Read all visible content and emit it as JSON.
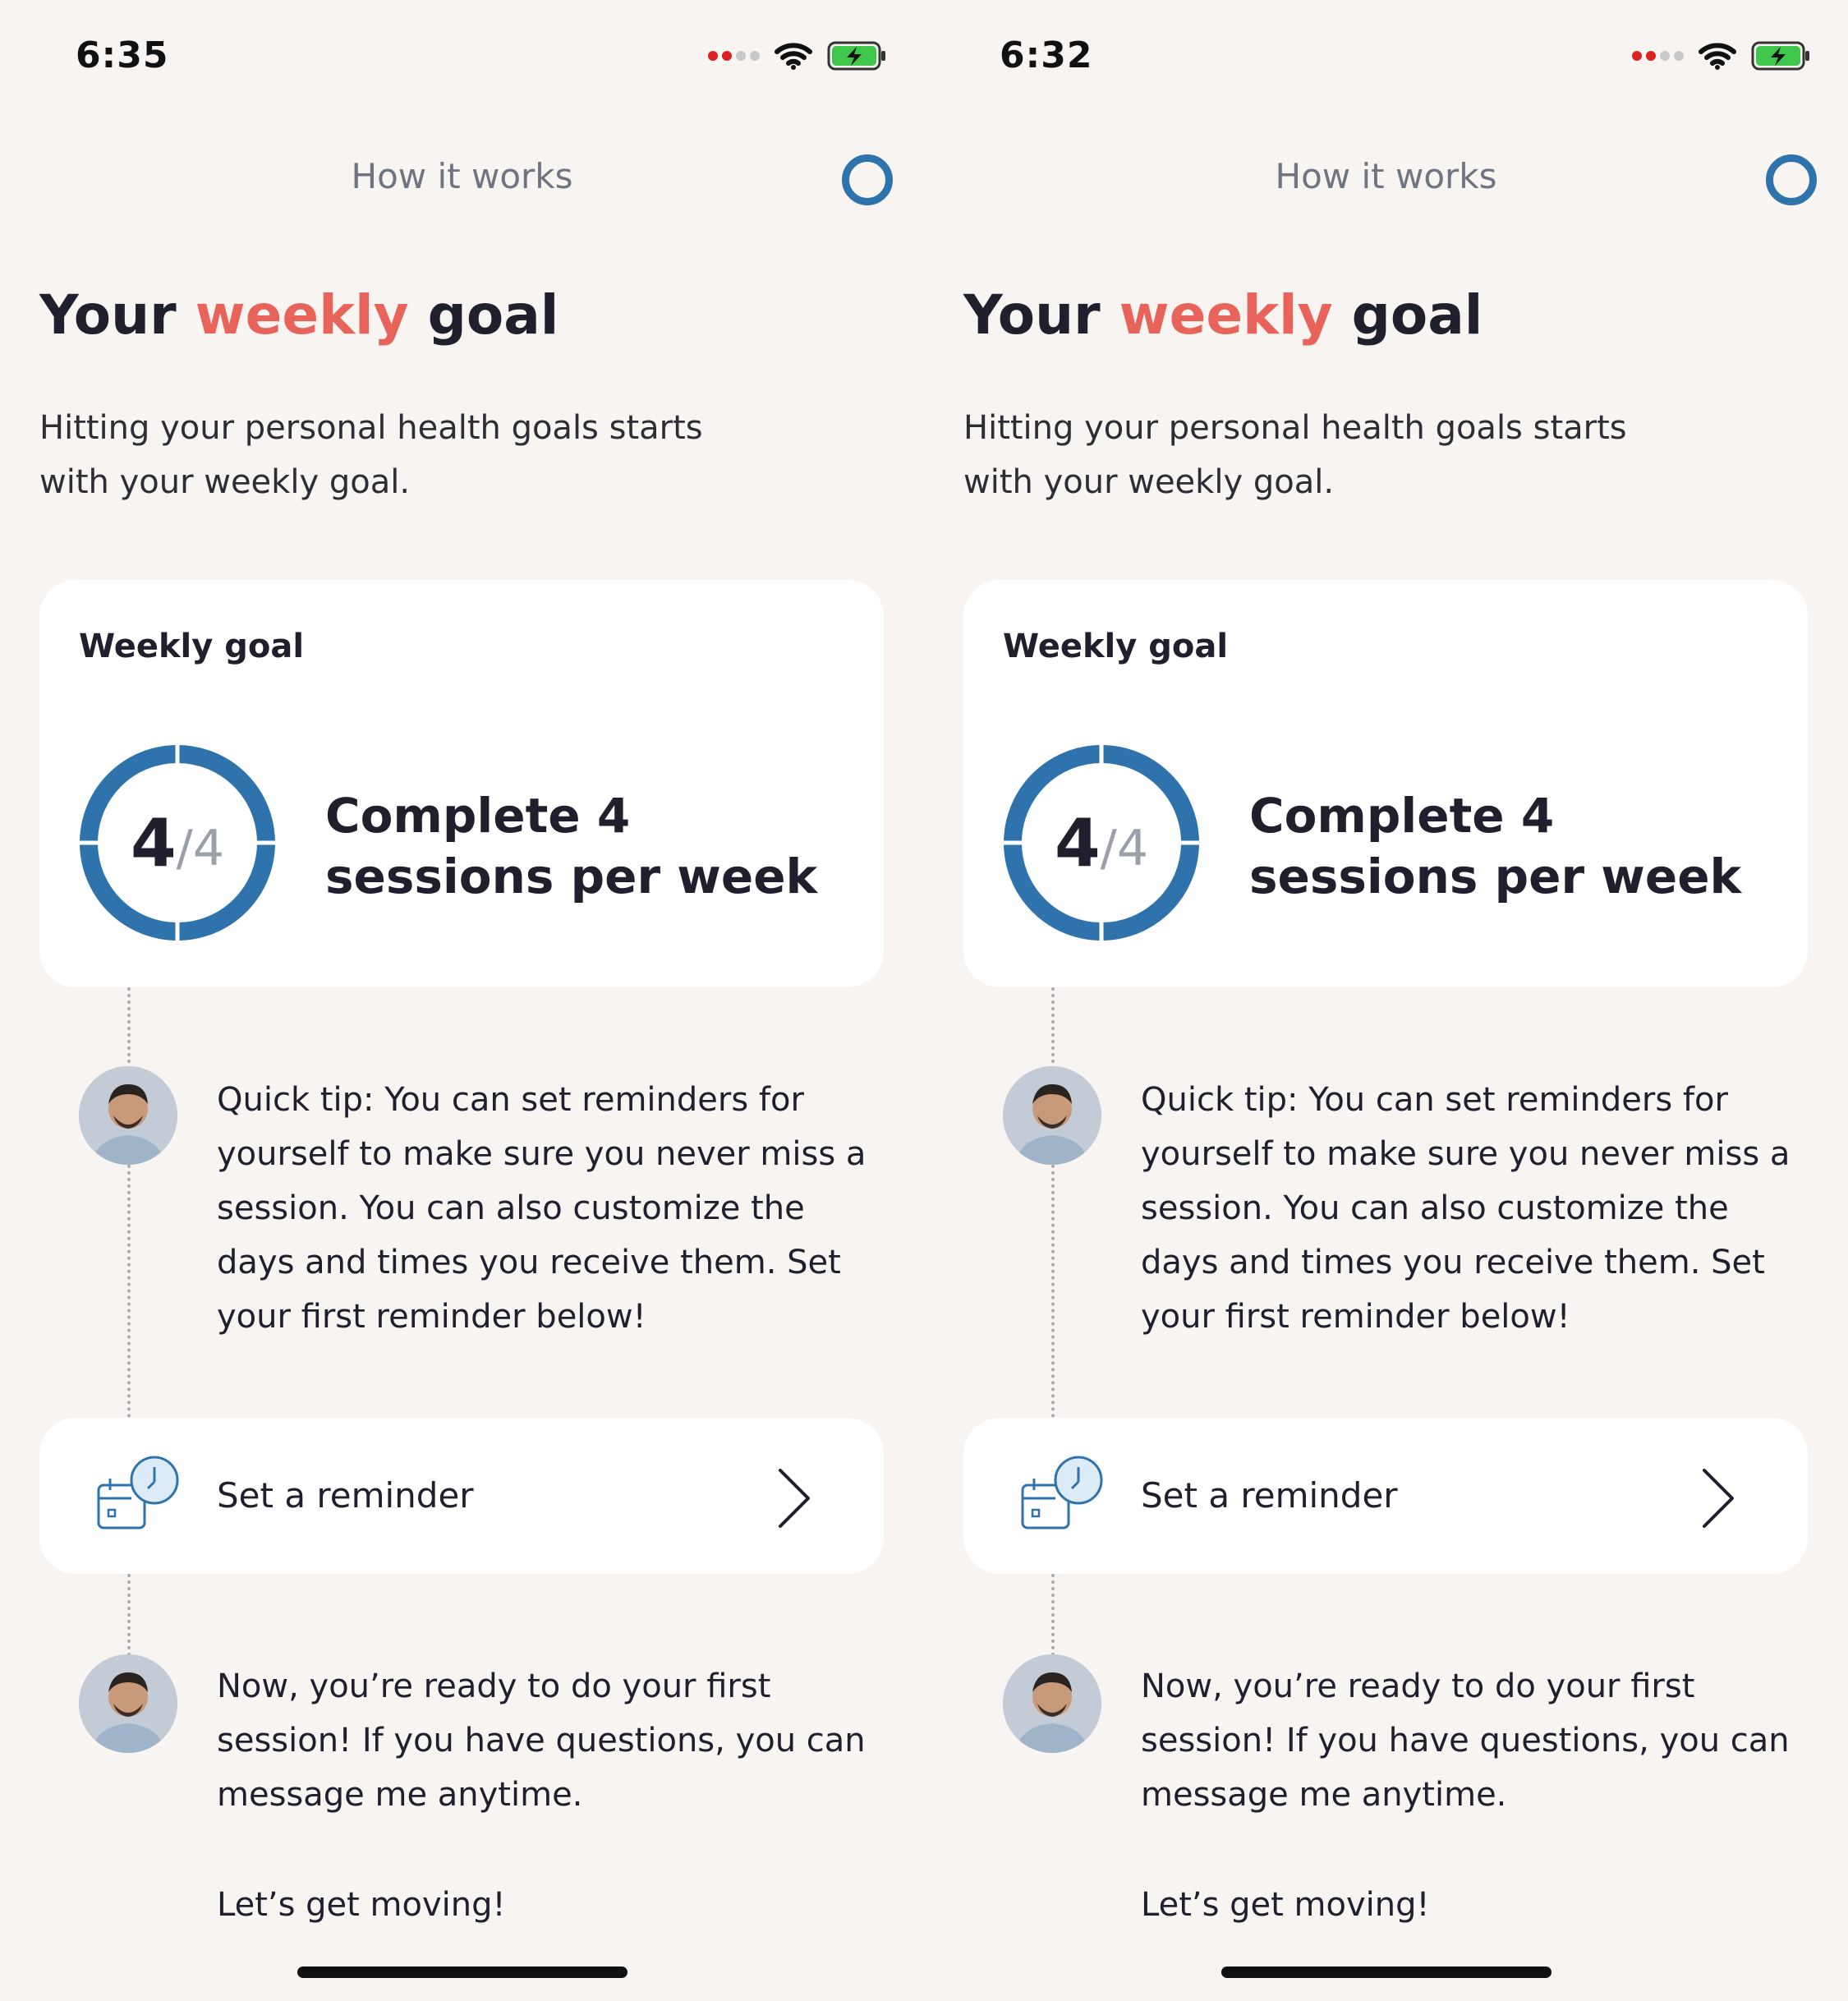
{
  "screens": [
    {
      "status": {
        "time": "6:35"
      },
      "header": {
        "title": "How it works"
      },
      "heading": {
        "prefix": "Your",
        "accent": "weekly",
        "suffix": "goal"
      },
      "subtitle": "Hitting your personal health goals starts with your weekly goal.",
      "goal_card": {
        "label": "Weekly goal",
        "progress_done": "4",
        "progress_total": "/4",
        "description": "Complete 4 sessions per week"
      },
      "tip": {
        "text": "Quick tip: You can set reminders for yourself to make sure you never miss a session. You can also customize the days and times you receive them. Set your first reminder below!"
      },
      "reminder": {
        "label": "Set a reminder"
      },
      "final_message": {
        "line1": "Now, you’re ready to do your first session! If you have questions, you can message me anytime.",
        "line2": "Let’s get moving!"
      }
    },
    {
      "status": {
        "time": "6:32"
      },
      "header": {
        "title": "How it works"
      },
      "heading": {
        "prefix": "Your",
        "accent": "weekly",
        "suffix": "goal"
      },
      "subtitle": "Hitting your personal health goals starts with your weekly goal.",
      "goal_card": {
        "label": "Weekly goal",
        "progress_done": "4",
        "progress_total": "/4",
        "description": "Complete 4 sessions per week"
      },
      "tip": {
        "text": "Quick tip: You can set reminders for yourself to make sure you never miss a session. You can also customize the days and times you receive them. Set your first reminder below!"
      },
      "reminder": {
        "label": "Set a reminder"
      },
      "final_message": {
        "line1": "Now, you’re ready to do your first session! If you have questions, you can message me anytime.",
        "line2": "Let’s get moving!"
      }
    }
  ],
  "colors": {
    "accent": "#e8645a",
    "brand_blue": "#2f73ad",
    "background": "#f7f4f2",
    "card": "#ffffff",
    "text": "#1f1f2e",
    "muted": "#6e7480"
  },
  "icons": [
    "signal-icon",
    "wifi-icon",
    "battery-charging-icon",
    "help-circle-icon",
    "calendar-clock-icon",
    "chevron-right-icon",
    "coach-avatar"
  ]
}
